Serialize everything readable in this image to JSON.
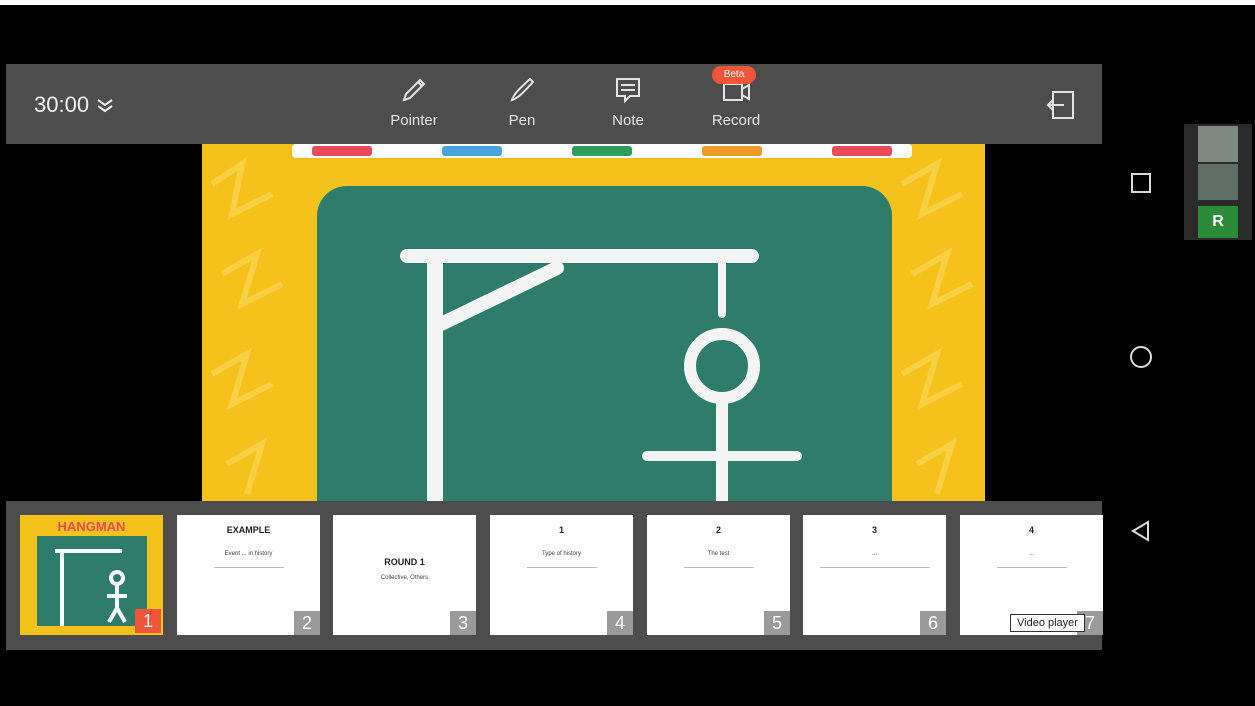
{
  "toolbar": {
    "timer": "30:00",
    "tools": [
      {
        "label": "Pointer",
        "icon": "pointer-pen-icon"
      },
      {
        "label": "Pen",
        "icon": "pen-icon"
      },
      {
        "label": "Note",
        "icon": "note-icon"
      },
      {
        "label": "Record",
        "icon": "record-icon"
      }
    ],
    "record_badge": "Beta"
  },
  "slide": {
    "background_color": "#f5c21c",
    "board_color": "#2e7d6a"
  },
  "thumbnails": [
    {
      "number": "1",
      "title": "HANGMAN",
      "body": "",
      "active": true
    },
    {
      "number": "2",
      "title": "EXAMPLE",
      "body": "Event ... in history",
      "active": false
    },
    {
      "number": "3",
      "title": "ROUND 1",
      "body": "Collective, Others",
      "active": false
    },
    {
      "number": "4",
      "title": "1",
      "body": "Type of history",
      "active": false
    },
    {
      "number": "5",
      "title": "2",
      "body": "The test",
      "active": false
    },
    {
      "number": "6",
      "title": "3",
      "body": "...",
      "active": false
    },
    {
      "number": "7",
      "title": "4",
      "body": "...",
      "active": false
    }
  ],
  "tooltip": "Video player",
  "participants": {
    "initial": "R"
  },
  "colors": {
    "accent": "#f0553a",
    "panel": "#4d4d4d"
  }
}
